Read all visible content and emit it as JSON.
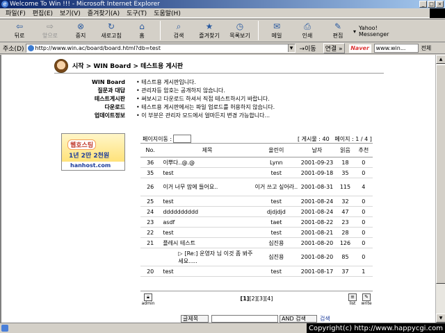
{
  "window": {
    "title": "Welcome To Win !!! - Microsoft Internet Explorer",
    "controls": [
      "_",
      "□",
      "×"
    ]
  },
  "menu": [
    "파일(F)",
    "편집(E)",
    "보기(V)",
    "즐겨찾기(A)",
    "도구(T)",
    "도움말(H)"
  ],
  "toolbar": {
    "back": "뒤로",
    "forward": "앞으로",
    "stop": "중지",
    "refresh": "새로고침",
    "home": "홈",
    "search": "검색",
    "favorites": "즐겨찾기",
    "history": "목록보기",
    "mail": "메일",
    "print": "인쇄",
    "edit": "편집",
    "messenger_line1": "Yahoo!",
    "messenger_line2": "Messenger"
  },
  "address": {
    "label": "주소(D)",
    "url": "http://www.win.ac/board/board.html?db=test",
    "go": "이동",
    "links": "연결 »",
    "naver_logo": "Naver",
    "naver_value": "www.win...",
    "naver_search": "전체"
  },
  "page": {
    "breadcrumb": "시작 > WIN Board > 테스트용 게시판",
    "info": [
      {
        "key": "WIN Board",
        "value": "테스트용 게시판입니다."
      },
      {
        "key": "질문과 대답",
        "value": "관리자등 암호는 공개하지 않습니다."
      },
      {
        "key": "테스트게시판",
        "value": "써보시고 다운로드 하셔서 직접 테스트하시기 바랍니다."
      },
      {
        "key": "다운로드",
        "value": "테스트용 게시판에서는 파일 업로드를 허용하지 않습니다."
      },
      {
        "key": "업데이트정보",
        "value": "이 부분은 관리자 모드에서 얼마든지 변경 가능합니다..."
      }
    ],
    "page_move_label": "페이지이동 :",
    "post_count": "[ 게시물 : 40",
    "page_info": "페이지 : 1 / 4 ]",
    "banner": {
      "title": "웹호스팅",
      "subtitle": "1년 2만 2천원",
      "url": "hanhost.com"
    },
    "table": {
      "headers": [
        "No.",
        "제목",
        "올린이",
        "날자",
        "읽음",
        "추천"
      ],
      "rows": [
        {
          "no": "36",
          "subject": "이뿌다..@.@",
          "author": "Lynn",
          "date": "2001-09-23",
          "reads": "18",
          "votes": "0"
        },
        {
          "no": "35",
          "subject": "test",
          "author": "test",
          "date": "2001-09-18",
          "reads": "35",
          "votes": "0"
        },
        {
          "no": "26",
          "subject": "이거 너무 맘에 들어요..",
          "author": "이거 쓰고 싶어라..",
          "date": "2001-08-31",
          "reads": "115",
          "votes": "4"
        },
        {
          "no": "25",
          "subject": "test",
          "author": "test",
          "date": "2001-08-24",
          "reads": "32",
          "votes": "0"
        },
        {
          "no": "24",
          "subject": "dddddddddd",
          "author": "djdjdjd",
          "date": "2001-08-24",
          "reads": "47",
          "votes": "0"
        },
        {
          "no": "23",
          "subject": "asdf",
          "author": "taet",
          "date": "2001-08-22",
          "reads": "23",
          "votes": "0"
        },
        {
          "no": "22",
          "subject": "test",
          "author": "test",
          "date": "2001-08-21",
          "reads": "28",
          "votes": "0"
        },
        {
          "no": "21",
          "subject": "플레시 테스트",
          "author": "심진용",
          "date": "2001-08-20",
          "reads": "126",
          "votes": "0"
        },
        {
          "no": "",
          "subject": "[Re:] 운영자 님 이것 좀 봐주세요.....",
          "author": "심진용",
          "date": "2001-08-20",
          "reads": "85",
          "votes": "0",
          "reply": true
        },
        {
          "no": "20",
          "subject": "test",
          "author": "test",
          "date": "2001-08-17",
          "reads": "37",
          "votes": "1"
        }
      ]
    },
    "admin_label": "admin",
    "list_label": "list",
    "write_label": "write",
    "pages": [
      "[1]",
      "[2]",
      "[3]",
      "[4]"
    ],
    "search_field": "글제목",
    "search_mode": "AND 검색",
    "search_button": "검색"
  },
  "status": {
    "copyright": "Copyright(c) http://www.happycgi.com"
  },
  "colors": {
    "titlebar_start": "#0a246a",
    "titlebar_end": "#a6caf0",
    "chrome": "#d4d0c8",
    "link_blue": "#1a3a9a"
  }
}
